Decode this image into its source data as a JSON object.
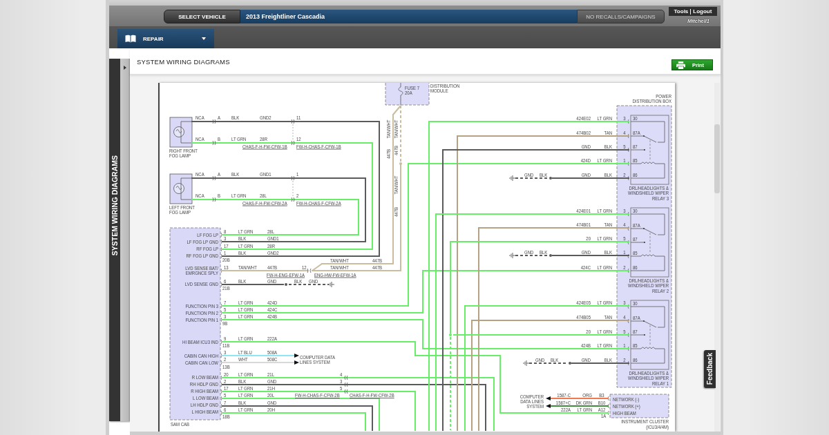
{
  "header": {
    "select_vehicle": "SELECT VEHICLE",
    "vehicle": "2013 Freightliner Cascadia",
    "recalls": "NO RECALLS/CAMPAIGNS",
    "links": [
      "Tools",
      "Logout"
    ],
    "logo": "Mitchell1"
  },
  "nav": {
    "menu": "REPAIR"
  },
  "side_panel": {
    "title": "SYSTEM WIRING DIAGRAMS"
  },
  "page": {
    "title": "SYSTEM WIRING DIAGRAMS",
    "print": "Print"
  },
  "diagram": {
    "fuse": {
      "label": [
        "FUSE 7",
        "20A"
      ],
      "caption": [
        "DISTRIBUTION",
        "MODULE"
      ]
    },
    "lamps": [
      {
        "caption": [
          "RIGHT FRONT",
          "FOG LAMP"
        ]
      },
      {
        "caption": [
          "LEFT FRONT",
          "FOG LAMP"
        ]
      }
    ],
    "sam_cab": {
      "name": "SAM CAB",
      "pins": [
        [
          "LF FOG LP"
        ],
        [
          "LF FOG LP GND"
        ],
        [
          "RF FOG LP"
        ],
        [
          "RF FOG LP GND"
        ],
        [
          "LVD SENSE BAT/",
          "EMRGNCE SPLY"
        ],
        [
          "LVD SENSE GND"
        ],
        [
          "FUNCTION PIN 3"
        ],
        [
          "FUNCTION PIN 2"
        ],
        [
          "FUNCTION PIN 1"
        ],
        [
          "HI BEAM ICU3 IND"
        ],
        [
          "CABIN CAN HIGH"
        ],
        [
          "CABIN CAN LOW"
        ],
        [
          "R LOW BEAM"
        ],
        [
          "RH HDLP GND"
        ],
        [
          "R HIGH BEAM"
        ],
        [
          "L LOW BEAM"
        ],
        [
          "LH HDLP GND"
        ],
        [
          "L HIGH BEAM"
        ]
      ],
      "connectors": [
        "20B",
        "21B",
        "9B",
        "11B",
        "13B",
        "18B"
      ]
    },
    "power_distribution_box": {
      "caption": [
        "POWER",
        "DISTRIBUTION BOX"
      ],
      "relays": [
        {
          "terminals": [
            "30",
            "87A",
            "87",
            "85",
            "86"
          ],
          "caption": [
            "DRL/HEADLIGHTS &",
            "WINDSHIELD WIPER",
            "RELAY 3"
          ]
        },
        {
          "terminals": [
            "30",
            "87A",
            "87",
            "85",
            "86"
          ],
          "caption": [
            "DRL/HEADLIGHTS &",
            "WINDSHIELD WIPER",
            "RELAY 2"
          ]
        },
        {
          "terminals": [
            "30",
            "87A",
            "87",
            "85",
            "86"
          ],
          "caption": [
            "DRL/HEADLIGHTS &",
            "WINDSHIELD WIPER",
            "RELAY 1"
          ]
        }
      ]
    },
    "instrument_cluster": {
      "pins": [
        "NETWORK (-)",
        "NETWORK (+)",
        "HIGH BEAM"
      ],
      "connector": "1A",
      "caption": [
        "INSTRUMENT CLUSTER",
        "(ICU3/4/4M)"
      ]
    },
    "data_lines": [
      {
        "caption": [
          "COMPUTER DATA",
          "LINES SYSTEM"
        ]
      },
      {
        "caption": [
          "COMPUTER",
          "DATA LINES",
          "SYSTEM"
        ]
      }
    ],
    "wires": [
      {
        "color": "#5a5a5a",
        "labels": [
          "NCA",
          "A",
          "BLK",
          "GND2",
          "11",
          "1",
          "BLK",
          "GND2"
        ]
      },
      {
        "color": "#66ee66",
        "labels": [
          "NCA",
          "B",
          "LT GRN",
          "28R",
          "12",
          "CHAS-F-H-FW-CFW-1B",
          "FW-H-CHAS-F-CFW-1B",
          "17",
          "LT GRN",
          "28R"
        ]
      },
      {
        "color": "#5a5a5a",
        "labels": [
          "NCA",
          "A",
          "BLK",
          "GND1",
          "1",
          "3",
          "BLK",
          "GND1"
        ]
      },
      {
        "color": "#66ee66",
        "labels": [
          "NCA",
          "B",
          "LT GRN",
          "28L",
          "2",
          "CHAS-F-H-FW-CFW-2A",
          "FW-H-CHAS-F-CFW-2A",
          "8",
          "LT GRN",
          "28L"
        ]
      },
      {
        "color": "#c9bc9f",
        "labels": [
          "TAN/WHT",
          "447B",
          "TAN/WHT",
          "447B"
        ]
      },
      {
        "color": "#c9bc9f",
        "labels": [
          "TAN/WHT",
          "447B",
          "TAN/WHT",
          "447B",
          "TAN/WHT",
          "447B"
        ]
      },
      {
        "color": "#c9bc9f",
        "labels": [
          "13",
          "TAN/WHT",
          "447B",
          "12",
          "FW-H-ENG-EFW-1A",
          "ENG-HW-FW-EFW-1A"
        ]
      },
      {
        "color": "#5a5a5a",
        "labels": [
          "6",
          "BLK",
          "GND",
          "BLK",
          "GND"
        ]
      },
      {
        "color": "#66ee66",
        "labels": [
          "7",
          "LT GRN",
          "424D",
          "424D",
          "LT GRN",
          "1"
        ]
      },
      {
        "color": "#66ee66",
        "labels": [
          "5",
          "LT GRN",
          "424C",
          "424C",
          "LT GRN",
          "2"
        ]
      },
      {
        "color": "#66ee66",
        "labels": [
          "3",
          "LT GRN",
          "424B",
          "424B",
          "LT GRN",
          "1"
        ]
      },
      {
        "color": "#66ee66",
        "labels": [
          "9",
          "LT GRN",
          "222A",
          "222A",
          "LT GRN",
          "A12"
        ]
      },
      {
        "color": "#8ee6f2",
        "labels": [
          "3",
          "LT BLU",
          "508A"
        ]
      },
      {
        "color": "#d8d8d8",
        "labels": [
          "2",
          "WHT",
          "508C"
        ]
      },
      {
        "color": "#66ee66",
        "labels": [
          "20",
          "LT GRN",
          "21L",
          "4"
        ]
      },
      {
        "color": "#5a5a5a",
        "labels": [
          "2",
          "BLK",
          "GND",
          "3"
        ]
      },
      {
        "color": "#66ee66",
        "labels": [
          "17",
          "LT GRN",
          "21H",
          "5",
          "FW-H-CHAS-F-CFW-2B",
          "CHAS-F-H-FW-CFW-2B"
        ]
      },
      {
        "color": "#66ee66",
        "labels": [
          "5",
          "LT GRN",
          "20L"
        ]
      },
      {
        "color": "#5a5a5a",
        "labels": [
          "7",
          "BLK",
          "GND"
        ]
      },
      {
        "color": "#66ee66",
        "labels": [
          "6",
          "LT GRN",
          "20H"
        ]
      },
      {
        "color": "#66ee66",
        "labels": [
          "424E02",
          "LT GRN",
          "3"
        ]
      },
      {
        "color": "#b5a282",
        "labels": [
          "474B02",
          "TAN",
          "4"
        ]
      },
      {
        "color": "#5a5a5a",
        "labels": [
          "GND",
          "BLK",
          "5"
        ]
      },
      {
        "color": "#5a5a5a",
        "labels": [
          "GND",
          "BLK",
          "GND",
          "BLK",
          "2"
        ]
      },
      {
        "color": "#66ee66",
        "labels": [
          "424E01",
          "LT GRN",
          "3"
        ]
      },
      {
        "color": "#b5a282",
        "labels": [
          "474B01",
          "TAN",
          "4"
        ]
      },
      {
        "color": "#66ee66",
        "labels": [
          "20",
          "LT GRN",
          "5"
        ]
      },
      {
        "color": "#5a5a5a",
        "labels": [
          "GND",
          "BLK",
          "GND",
          "BLK",
          "1"
        ]
      },
      {
        "color": "#66ee66",
        "labels": [
          "424E05",
          "LT GRN",
          "3"
        ]
      },
      {
        "color": "#b5a282",
        "labels": [
          "474B05",
          "TAN",
          "4"
        ]
      },
      {
        "color": "#66ee66",
        "labels": [
          "20",
          "LT GRN",
          "5"
        ]
      },
      {
        "color": "#5a5a5a",
        "labels": [
          "GND",
          "BLK",
          "GND",
          "BLK",
          "2"
        ]
      },
      {
        "color": "#f07a50",
        "labels": [
          "1587-C",
          "ORG",
          "B3"
        ]
      },
      {
        "color": "#3d8b3d",
        "labels": [
          "1587+C",
          "DK GRN",
          "B10"
        ]
      }
    ]
  },
  "feedback": "Feedback"
}
